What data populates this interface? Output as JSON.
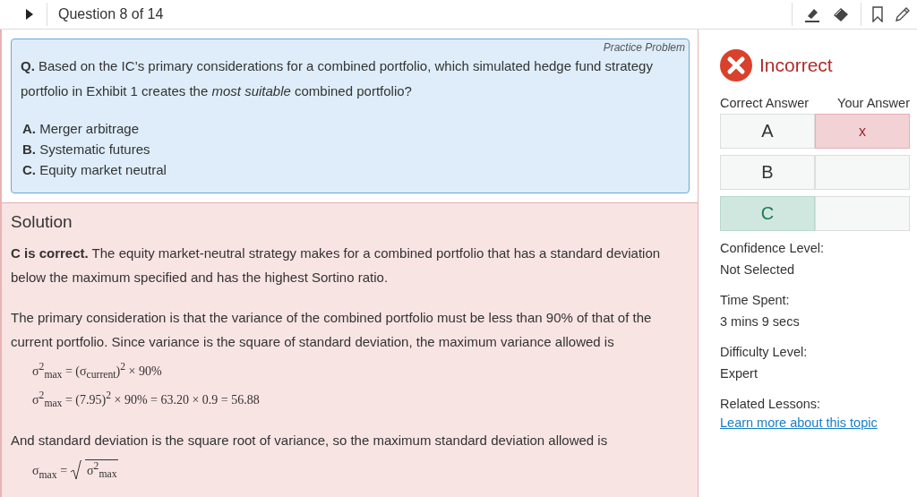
{
  "top_bar": {
    "title": "Question 8 of 14"
  },
  "question": {
    "tag": "Practice Problem",
    "prompt": "**Q.** Based on the IC’s primary considerations for a combined portfolio, which simulated hedge fund strategy portfolio in Exhibit 1 creates the *most suitable* combined portfolio?",
    "options": [
      {
        "letter": "A.",
        "text": "Merger arbitrage"
      },
      {
        "letter": "B.",
        "text": "Systematic futures"
      },
      {
        "letter": "C.",
        "text": "Equity market neutral"
      }
    ]
  },
  "solution": {
    "heading": "Solution",
    "blocks": [
      {
        "kind": "paragraph",
        "text": "**C is correct.** The equity market-neutral strategy makes for a combined portfolio that has a standard deviation below the maximum specified and has the highest Sortino ratio."
      },
      {
        "kind": "paragraph",
        "text": "The primary consideration is that the variance of the combined portfolio must be less than 90% of that of the current portfolio. Since variance is the square of standard deviation, the maximum variance allowed is"
      },
      {
        "kind": "equation",
        "text": "σ$^{2}$$_{max}$ = (σ$_{current}$)$^{2}$ × 90%"
      },
      {
        "kind": "equation",
        "text": "σ$^{2}$$_{max}$ = (7.95)$^{2}$ × 90% = 63.20 × 0.9 = 56.88"
      },
      {
        "kind": "paragraph",
        "text": "And standard deviation is the square root of variance, so the maximum standard deviation allowed is"
      },
      {
        "kind": "root",
        "lhs": "σ$_{max}$ =",
        "radicand": "σ$^{2}$$_{max}$"
      }
    ]
  },
  "result": {
    "verdict": "Incorrect",
    "columns": [
      "Correct Answer",
      "Your Answer"
    ],
    "rows": [
      {
        "choice": "A",
        "correct": false,
        "mark": "x",
        "chosen": true
      },
      {
        "choice": "B",
        "correct": false,
        "chosen": false
      },
      {
        "choice": "C",
        "correct": true,
        "chosen": false
      }
    ],
    "details": [
      {
        "label": "Confidence Level:",
        "value": "Not Selected"
      },
      {
        "label": "Time Spent:",
        "value": "3 mins 9 secs"
      },
      {
        "label": "Difficulty Level:",
        "value": "Expert"
      }
    ],
    "lessons": {
      "label": "Related Lessons:",
      "link": "Learn more about this topic"
    }
  }
}
